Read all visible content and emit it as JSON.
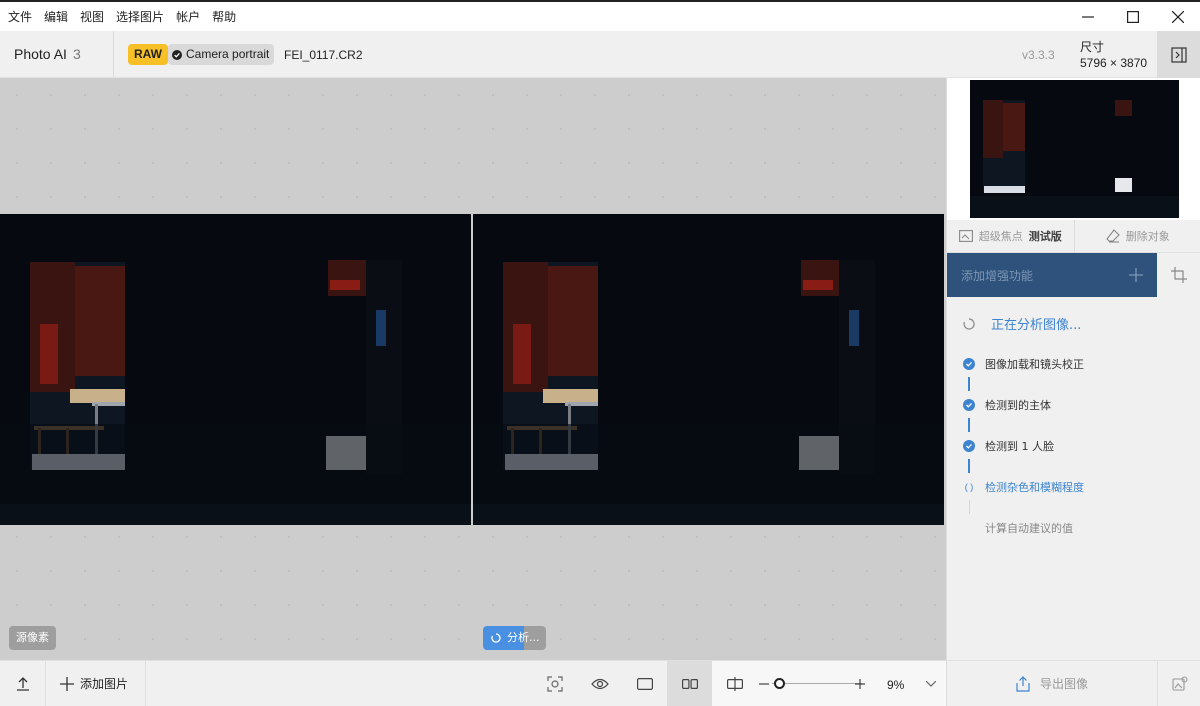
{
  "menu": {
    "items": [
      "文件",
      "编辑",
      "视图",
      "选择图片",
      "帐户",
      "帮助"
    ]
  },
  "window_controls": [
    "minimize-icon",
    "maximize-icon",
    "close-icon"
  ],
  "header": {
    "app_name": "Photo AI",
    "image_count": "3",
    "raw_badge": "RAW",
    "camera_badge": "Camera portrait",
    "file_name": "FEI_0117.CR2",
    "version": "v3.3.3",
    "size_label": "尺寸",
    "size_value": "5796 × 3870"
  },
  "canvas": {
    "pixel_button": "源像素",
    "analyze_button": "分析..."
  },
  "bottombar": {
    "add_image": "添加图片",
    "zoom_percent": "9%",
    "zoom_level": 0.09
  },
  "panel": {
    "tab_focus_label": "超级焦点",
    "tab_focus_beta": "测试版",
    "tab_remove": "删除对象",
    "enhance_label": "添加增强功能",
    "analyzing_title": "正在分析图像...",
    "steps": [
      {
        "label": "图像加载和镜头校正",
        "status": "done"
      },
      {
        "label": "检测到的主体",
        "status": "done"
      },
      {
        "label": "检测到 1 人脸",
        "status": "done"
      },
      {
        "label": "检测杂色和模糊程度",
        "status": "active"
      },
      {
        "label": "计算自动建议的值",
        "status": "todo"
      }
    ],
    "export_label": "导出图像"
  },
  "colors": {
    "accent_blue": "#3c84d0",
    "enhance_bg": "#2f527c",
    "raw_badge_bg": "#f6c026"
  }
}
